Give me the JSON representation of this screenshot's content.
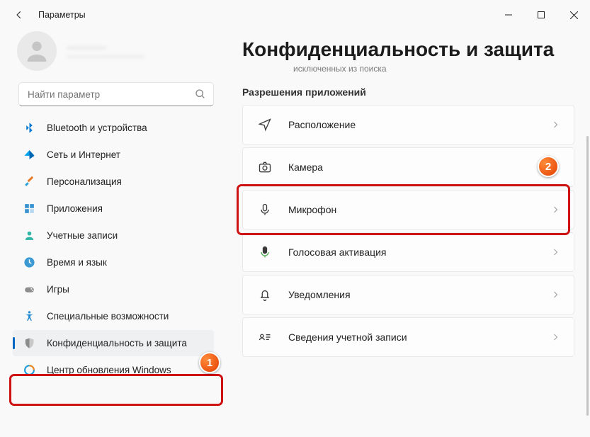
{
  "window": {
    "title": "Параметры"
  },
  "profile": {
    "name": "————",
    "email": "——————————"
  },
  "search": {
    "placeholder": "Найти параметр"
  },
  "sidebar": {
    "items": [
      {
        "label": "Bluetooth и устройства"
      },
      {
        "label": "Сеть и Интернет"
      },
      {
        "label": "Персонализация"
      },
      {
        "label": "Приложения"
      },
      {
        "label": "Учетные записи"
      },
      {
        "label": "Время и язык"
      },
      {
        "label": "Игры"
      },
      {
        "label": "Специальные возможности"
      },
      {
        "label": "Конфиденциальность и защита"
      },
      {
        "label": "Центр обновления Windows"
      }
    ]
  },
  "main": {
    "header": "Конфиденциальность и защита",
    "fragment": "исключенных из поиска",
    "section_title": "Разрешения приложений",
    "perms": [
      {
        "label": "Расположение"
      },
      {
        "label": "Камера"
      },
      {
        "label": "Микрофон"
      },
      {
        "label": "Голосовая активация"
      },
      {
        "label": "Уведомления"
      },
      {
        "label": "Сведения учетной записи"
      }
    ]
  },
  "annotations": {
    "badge1": "1",
    "badge2": "2"
  }
}
